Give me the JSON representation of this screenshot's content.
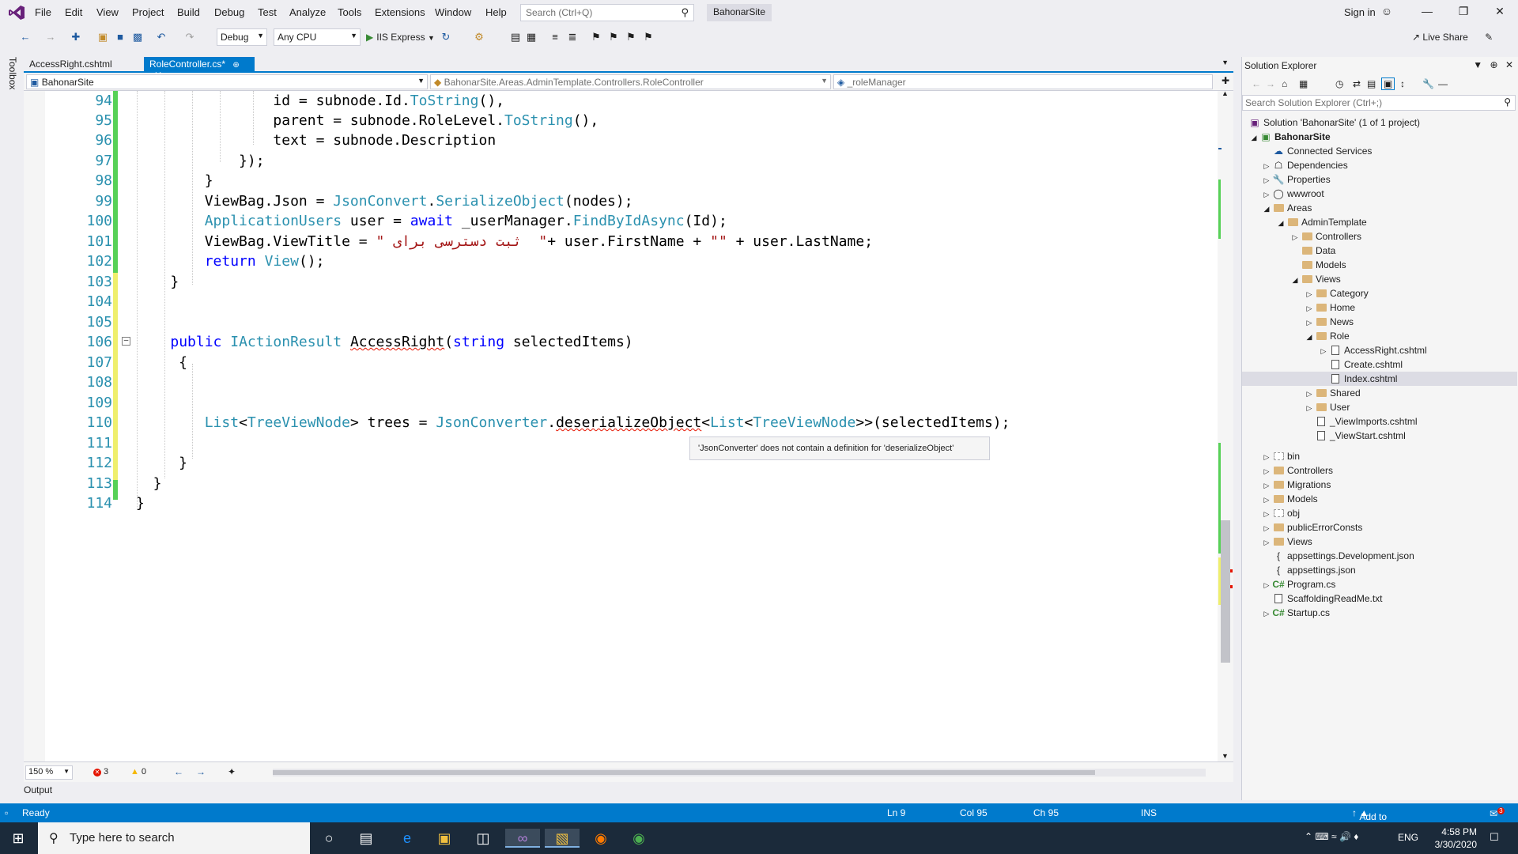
{
  "menu": {
    "items": [
      "File",
      "Edit",
      "View",
      "Project",
      "Build",
      "Debug",
      "Test",
      "Analyze",
      "Tools",
      "Extensions",
      "Window",
      "Help"
    ],
    "search_placeholder": "Search (Ctrl+Q)",
    "solution_name": "BahonarSite",
    "sign_in": "Sign in"
  },
  "toolbar": {
    "config": "Debug",
    "platform": "Any CPU",
    "run_target": "IIS Express",
    "live_share": "Live Share"
  },
  "toolbox_label": "Toolbox",
  "doc_tabs": [
    {
      "label": "AccessRight.cshtml",
      "active": false
    },
    {
      "label": "RoleController.cs*",
      "active": true
    }
  ],
  "navbar": {
    "project": "BahonarSite",
    "class": "BahonarSite.Areas.AdminTemplate.Controllers.RoleController",
    "member": "_roleManager"
  },
  "code_lines": [
    {
      "n": "94",
      "t": "                id = subnode.Id.ToString(),"
    },
    {
      "n": "95",
      "t": "                parent = subnode.RoleLevel.ToString(),"
    },
    {
      "n": "96",
      "t": "                text = subnode.Description"
    },
    {
      "n": "97",
      "t": "            });"
    },
    {
      "n": "98",
      "t": "        }"
    },
    {
      "n": "99",
      "t": "        ViewBag.Json = JsonConvert.SerializeObject(nodes);"
    },
    {
      "n": "100",
      "t": "        ApplicationUsers user = await _userManager.FindByIdAsync(Id);"
    },
    {
      "n": "101",
      "t": "        ViewBag.ViewTitle = \" ثبت دسترسی برای  \"+ user.FirstName + \"\" + user.LastName;"
    },
    {
      "n": "102",
      "t": "        return View();"
    },
    {
      "n": "103",
      "t": "    }"
    },
    {
      "n": "104",
      "t": ""
    },
    {
      "n": "105",
      "t": ""
    },
    {
      "n": "106",
      "t": "    public IActionResult AccessRight(string selectedItems)"
    },
    {
      "n": "107",
      "t": "     {"
    },
    {
      "n": "108",
      "t": ""
    },
    {
      "n": "109",
      "t": ""
    },
    {
      "n": "110",
      "t": "        List<TreeViewNode> trees = JsonConverter.deserializeObject<List<TreeViewNode>>(selectedItems);"
    },
    {
      "n": "111",
      "t": ""
    },
    {
      "n": "112",
      "t": "     }"
    },
    {
      "n": "113",
      "t": "  }"
    },
    {
      "n": "114",
      "t": "}"
    }
  ],
  "tooltip": "'JsonConverter' does not contain a definition for 'deserializeObject'",
  "editor_status": {
    "zoom": "150 %",
    "errors": "3",
    "warnings": "0"
  },
  "output_tab": "Output",
  "solution_explorer": {
    "title": "Solution Explorer",
    "search_placeholder": "Search Solution Explorer (Ctrl+;)",
    "nodes": [
      {
        "label": "Solution 'BahonarSite' (1 of 1 project)",
        "icon": "solution"
      },
      {
        "label": "BahonarSite",
        "icon": "project",
        "bold": true
      },
      {
        "label": "Connected Services",
        "icon": "connected-services"
      },
      {
        "label": "Dependencies",
        "icon": "dependencies"
      },
      {
        "label": "Properties",
        "icon": "properties"
      },
      {
        "label": "wwwroot",
        "icon": "globe"
      },
      {
        "label": "Areas",
        "icon": "folder"
      },
      {
        "label": "AdminTemplate",
        "icon": "folder"
      },
      {
        "label": "Controllers",
        "icon": "folder"
      },
      {
        "label": "Data",
        "icon": "folder"
      },
      {
        "label": "Models",
        "icon": "folder"
      },
      {
        "label": "Views",
        "icon": "folder"
      },
      {
        "label": "Category",
        "icon": "folder"
      },
      {
        "label": "Home",
        "icon": "folder"
      },
      {
        "label": "News",
        "icon": "folder"
      },
      {
        "label": "Role",
        "icon": "folder"
      },
      {
        "label": "AccessRight.cshtml",
        "icon": "razor-file"
      },
      {
        "label": "Create.cshtml",
        "icon": "razor-file"
      },
      {
        "label": "Index.cshtml",
        "icon": "razor-file",
        "selected": true
      },
      {
        "label": "Shared",
        "icon": "folder"
      },
      {
        "label": "User",
        "icon": "folder"
      },
      {
        "label": "_ViewImports.cshtml",
        "icon": "razor-file"
      },
      {
        "label": "_ViewStart.cshtml",
        "icon": "razor-file"
      },
      {
        "label": "bin",
        "icon": "folder-hidden"
      },
      {
        "label": "Controllers",
        "icon": "folder"
      },
      {
        "label": "Migrations",
        "icon": "folder"
      },
      {
        "label": "Models",
        "icon": "folder"
      },
      {
        "label": "obj",
        "icon": "folder-hidden"
      },
      {
        "label": "publicErrorConsts",
        "icon": "folder"
      },
      {
        "label": "Views",
        "icon": "folder"
      },
      {
        "label": "appsettings.Development.json",
        "icon": "json-file"
      },
      {
        "label": "appsettings.json",
        "icon": "json-file"
      },
      {
        "label": "Program.cs",
        "icon": "cs-file"
      },
      {
        "label": "ScaffoldingReadMe.txt",
        "icon": "text-file"
      },
      {
        "label": "Startup.cs",
        "icon": "cs-file"
      }
    ]
  },
  "statusbar": {
    "ready": "Ready",
    "ln": "Ln 9",
    "col": "Col 95",
    "ch": "Ch 95",
    "ins": "INS",
    "source_control": "Add to Source Control",
    "notifications": "3"
  },
  "taskbar": {
    "search_placeholder": "Type here to search",
    "lang": "ENG",
    "time": "4:58 PM",
    "date": "3/30/2020"
  },
  "colors": {
    "accent": "#007acc",
    "keyword": "#0000ff",
    "type": "#2b91af",
    "string": "#a31515",
    "error": "#e51400"
  }
}
